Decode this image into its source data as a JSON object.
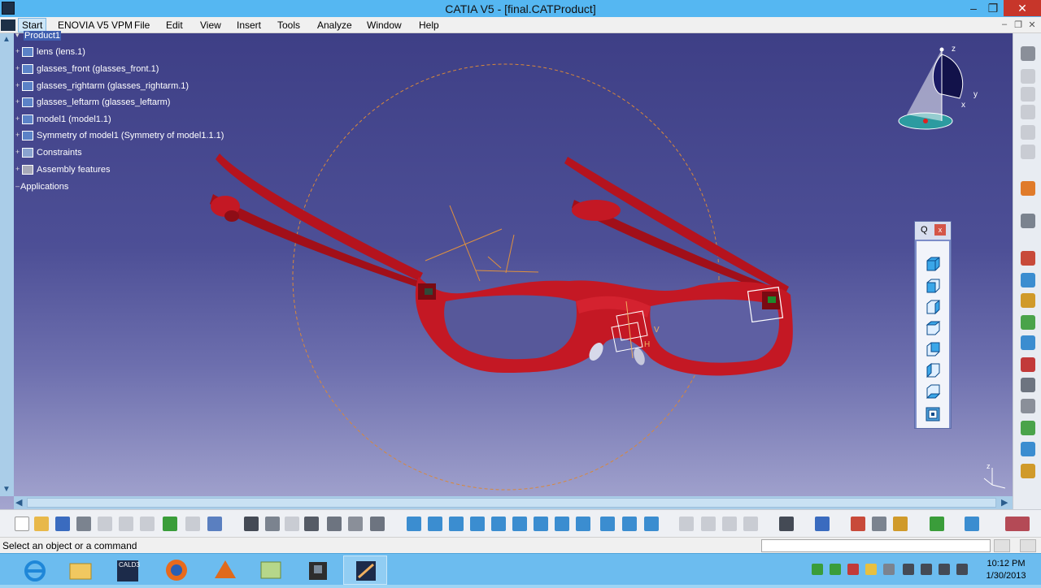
{
  "window": {
    "title": "CATIA V5 - [final.CATProduct]",
    "minimize": "–",
    "restore": "❐",
    "close": "✕"
  },
  "menu": {
    "items": [
      "Start",
      "ENOVIA V5 VPM",
      "File",
      "Edit",
      "View",
      "Insert",
      "Tools",
      "Analyze",
      "Window",
      "Help"
    ],
    "doc_minimize": "–",
    "doc_restore": "❐",
    "doc_close": "✕"
  },
  "tree": {
    "root": "Product1",
    "nodes": [
      "lens (lens.1)",
      "glasses_front (glasses_front.1)",
      "glasses_rightarm (glasses_rightarm.1)",
      "glasses_leftarm (glasses_leftarm)",
      "model1 (model1.1)",
      "Symmetry of model1 (Symmetry of model1.1.1)",
      "Constraints",
      "Assembly features",
      "Applications"
    ]
  },
  "compass": {
    "x": "x",
    "y": "y",
    "z": "z"
  },
  "axis_small": {
    "z": "z"
  },
  "manipulator": {
    "v": "V",
    "h": "H"
  },
  "view_toolbar": {
    "title": "Q",
    "close": "x",
    "buttons": [
      "isometric-view-icon",
      "front-view-icon",
      "back-view-icon",
      "left-view-icon",
      "right-view-icon",
      "top-view-icon",
      "bottom-view-icon",
      "named-views-icon"
    ]
  },
  "status": {
    "message": "Select an object or a command"
  },
  "clock": {
    "time": "10:12 PM",
    "date": "1/30/2013"
  },
  "taskbar": {
    "apps": [
      "internet-explorer-icon",
      "file-explorer-icon",
      "calc3-icon",
      "firefox-icon",
      "matlab-icon",
      "notes-icon",
      "tool-icon",
      "catia-icon"
    ],
    "calc_label": "CALD3"
  },
  "colors": {
    "frame_red": "#c41824",
    "viewport_top": "#3e3f86",
    "accent_blue": "#1f87d8"
  }
}
